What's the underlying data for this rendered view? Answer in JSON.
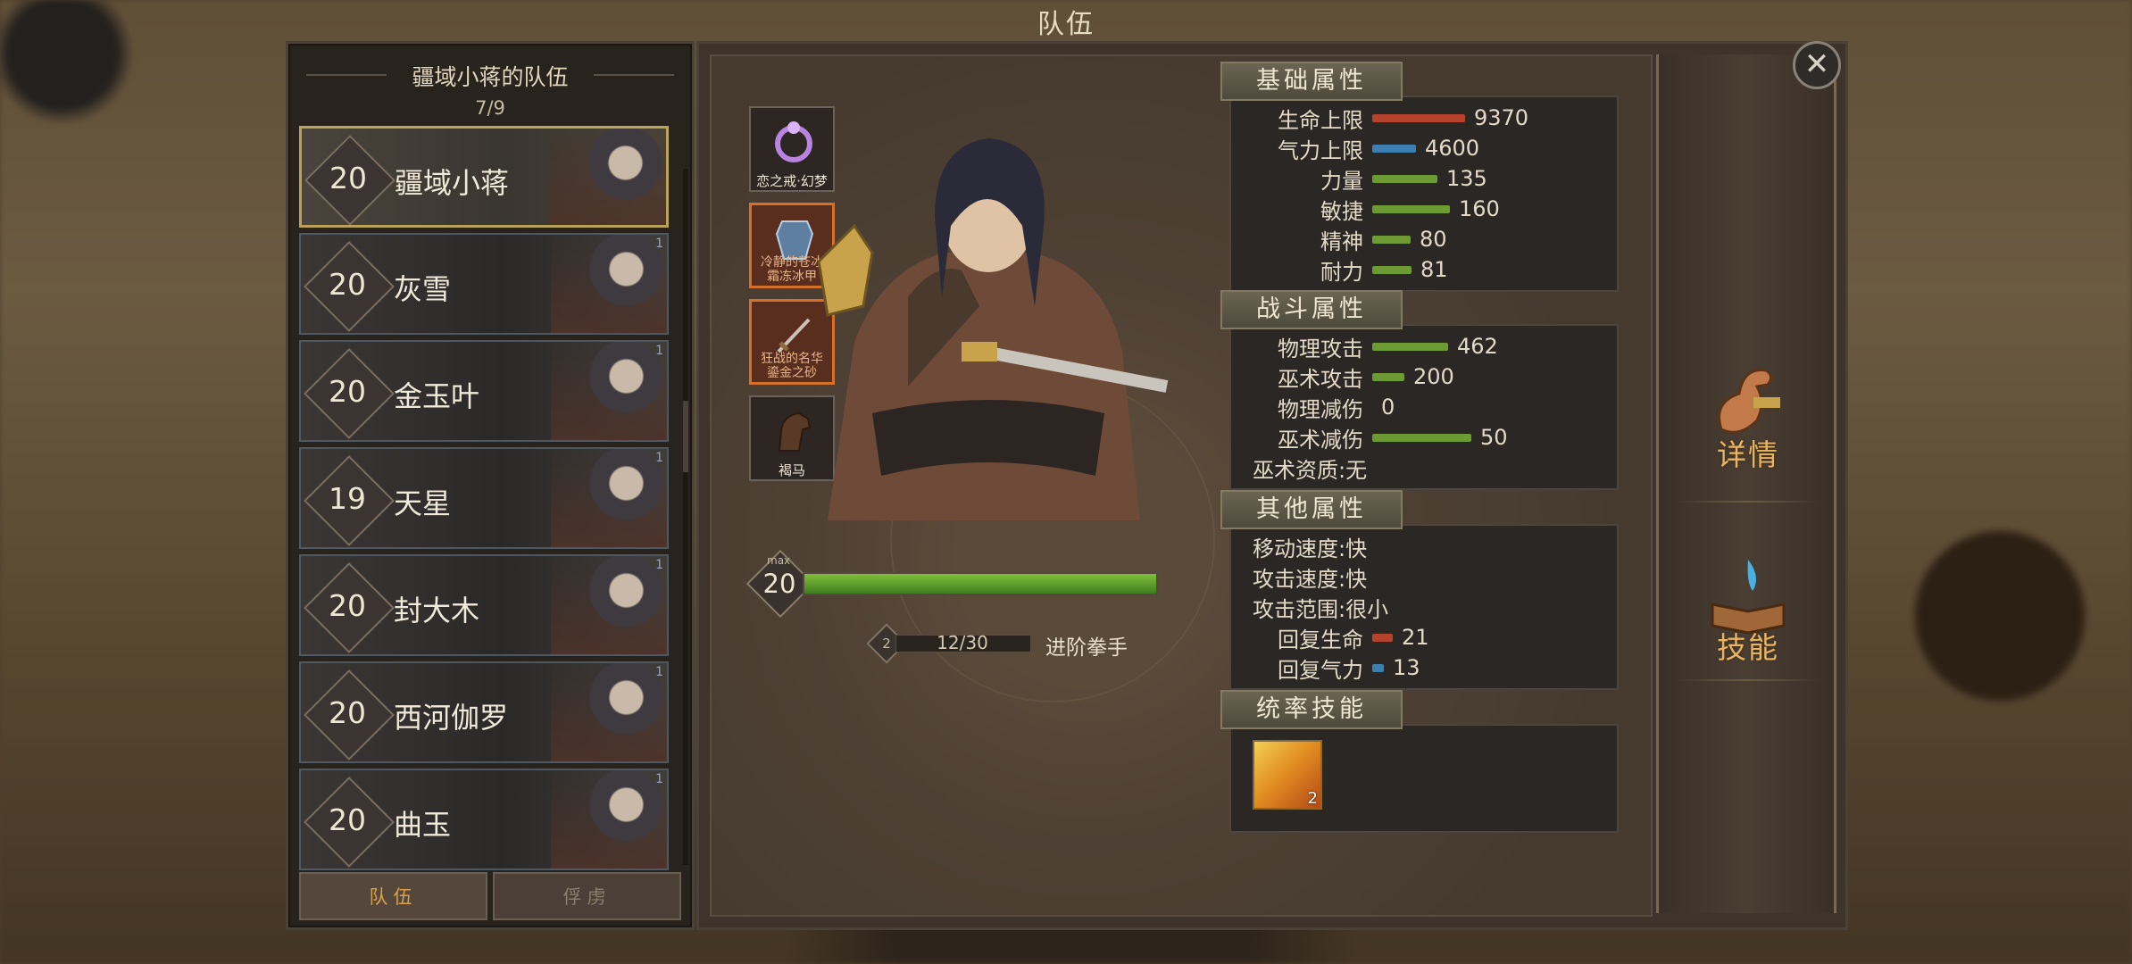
{
  "screen_title": "队伍",
  "roster": {
    "team_name": "疆域小蒋的队伍",
    "count": "7/9",
    "heroes": [
      {
        "level": "20",
        "name": "疆域小蒋",
        "corner": ""
      },
      {
        "level": "20",
        "name": "灰雪",
        "corner": "1"
      },
      {
        "level": "20",
        "name": "金玉叶",
        "corner": "1"
      },
      {
        "level": "19",
        "name": "天星",
        "corner": "1"
      },
      {
        "level": "20",
        "name": "封大木",
        "corner": "1"
      },
      {
        "level": "20",
        "name": "西河伽罗",
        "corner": "1"
      },
      {
        "level": "20",
        "name": "曲玉",
        "corner": "1"
      }
    ],
    "tabs": [
      "队伍",
      "俘虏"
    ]
  },
  "equipment": [
    {
      "label": "恋之戒·幻梦",
      "icon": "ring-icon"
    },
    {
      "label": "冷静的苍冰\n霜冻冰甲",
      "icon": "armor-icon"
    },
    {
      "label": "狂战的名华\n鎏金之砂",
      "icon": "weapon-icon"
    },
    {
      "label": "褐马",
      "icon": "horse-icon"
    }
  ],
  "level": {
    "max_label": "max",
    "value": "20",
    "progress": 1.0
  },
  "class": {
    "badge": "2",
    "progress": "12/30",
    "name": "进阶拳手"
  },
  "basic_stats": {
    "title": "基础属性",
    "rows": [
      {
        "label": "生命上限",
        "value": "9370",
        "color": "#b5432c",
        "ratio": 0.8
      },
      {
        "label": "气力上限",
        "value": "4600",
        "color": "#3e7fb2",
        "ratio": 0.38
      },
      {
        "label": "力量",
        "value": "135",
        "color": "#6d9a33",
        "ratio": 0.56
      },
      {
        "label": "敏捷",
        "value": "160",
        "color": "#6d9a33",
        "ratio": 0.67
      },
      {
        "label": "精神",
        "value": "80",
        "color": "#6d9a33",
        "ratio": 0.33
      },
      {
        "label": "耐力",
        "value": "81",
        "color": "#6d9a33",
        "ratio": 0.34
      }
    ]
  },
  "combat_stats": {
    "title": "战斗属性",
    "rows": [
      {
        "label": "物理攻击",
        "value": "462",
        "color": "#6d9a33",
        "ratio": 0.65,
        "type": "bar"
      },
      {
        "label": "巫术攻击",
        "value": "200",
        "color": "#6d9a33",
        "ratio": 0.28,
        "type": "bar"
      },
      {
        "label": "物理减伤",
        "value": "0",
        "color": "#6d9a33",
        "ratio": 0,
        "type": "bar"
      },
      {
        "label": "巫术减伤",
        "value": "50",
        "color": "#6d9a33",
        "ratio": 0.85,
        "type": "bar"
      },
      {
        "label": "巫术资质",
        "value": ":无",
        "type": "text"
      }
    ]
  },
  "other_stats": {
    "title": "其他属性",
    "rows": [
      {
        "label": "移动速度",
        "value": ":快",
        "type": "text"
      },
      {
        "label": "攻击速度",
        "value": ":快",
        "type": "text"
      },
      {
        "label": "攻击范围",
        "value": ":很小",
        "type": "text"
      },
      {
        "label": "回复生命",
        "value": "21",
        "color": "#b5432c",
        "ratio": 0.18,
        "type": "bar"
      },
      {
        "label": "回复气力",
        "value": "13",
        "color": "#3e7fb2",
        "ratio": 0.1,
        "type": "bar"
      }
    ]
  },
  "command_skill": {
    "title": "统率技能",
    "skill_level": "2"
  },
  "side_buttons": [
    {
      "label": "详情",
      "icon": "arm-muscle-icon"
    },
    {
      "label": "技能",
      "icon": "skill-book-icon"
    }
  ],
  "close_label": "✕"
}
